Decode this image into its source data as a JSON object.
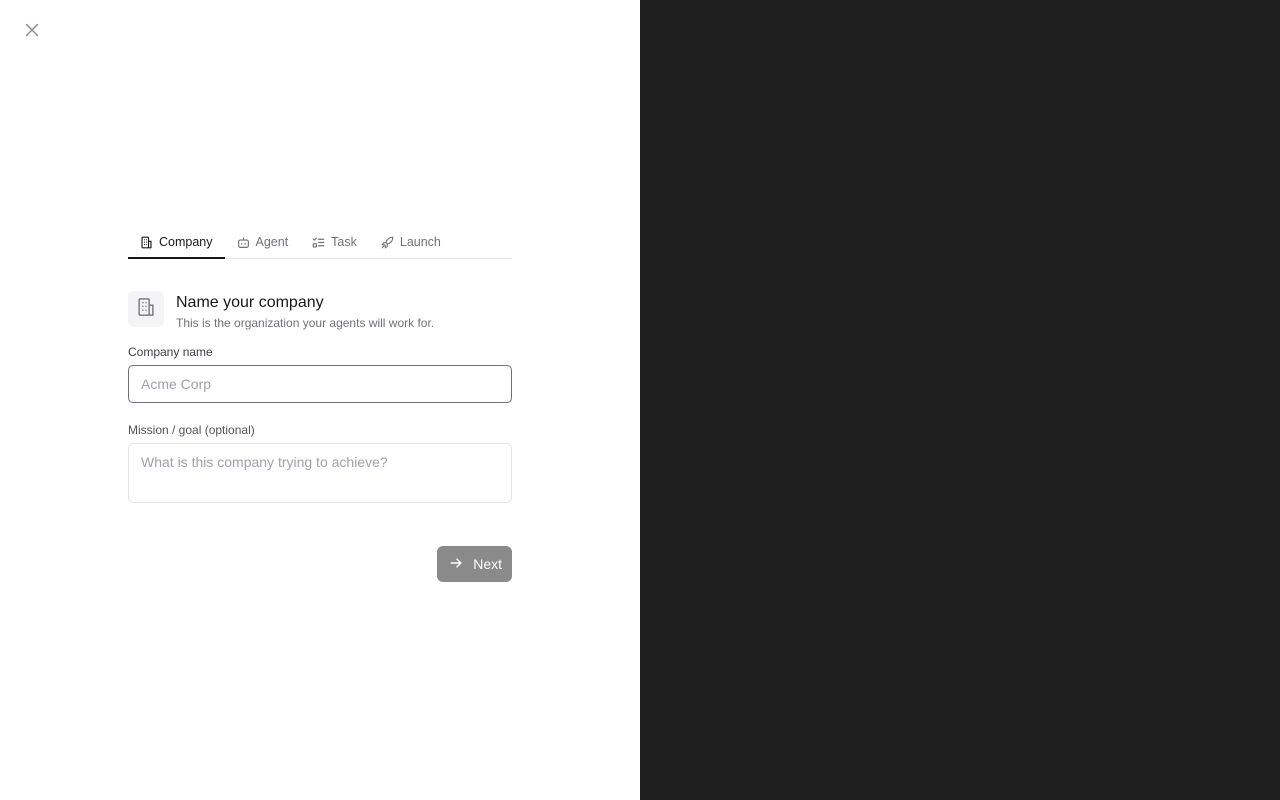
{
  "colors": {
    "right_pane_background": "#1f1f1f",
    "active_tab_underline": "#18181b",
    "next_button_background": "#8a8a8a"
  },
  "close_button": {
    "icon": "close-icon"
  },
  "tabs": [
    {
      "label": "Company",
      "icon": "building-icon",
      "active": true
    },
    {
      "label": "Agent",
      "icon": "bot-icon",
      "active": false
    },
    {
      "label": "Task",
      "icon": "list-checks-icon",
      "active": false
    },
    {
      "label": "Launch",
      "icon": "rocket-icon",
      "active": false
    }
  ],
  "step": {
    "icon": "building-icon",
    "title": "Name your company",
    "subtitle": "This is the organization your agents will work for."
  },
  "fields": {
    "company_name": {
      "label": "Company name",
      "placeholder": "Acme Corp",
      "value": ""
    },
    "mission": {
      "label": "Mission / goal (optional)",
      "placeholder": "What is this company trying to achieve?",
      "value": ""
    }
  },
  "actions": {
    "next_label": "Next",
    "next_icon": "arrow-right-icon"
  }
}
